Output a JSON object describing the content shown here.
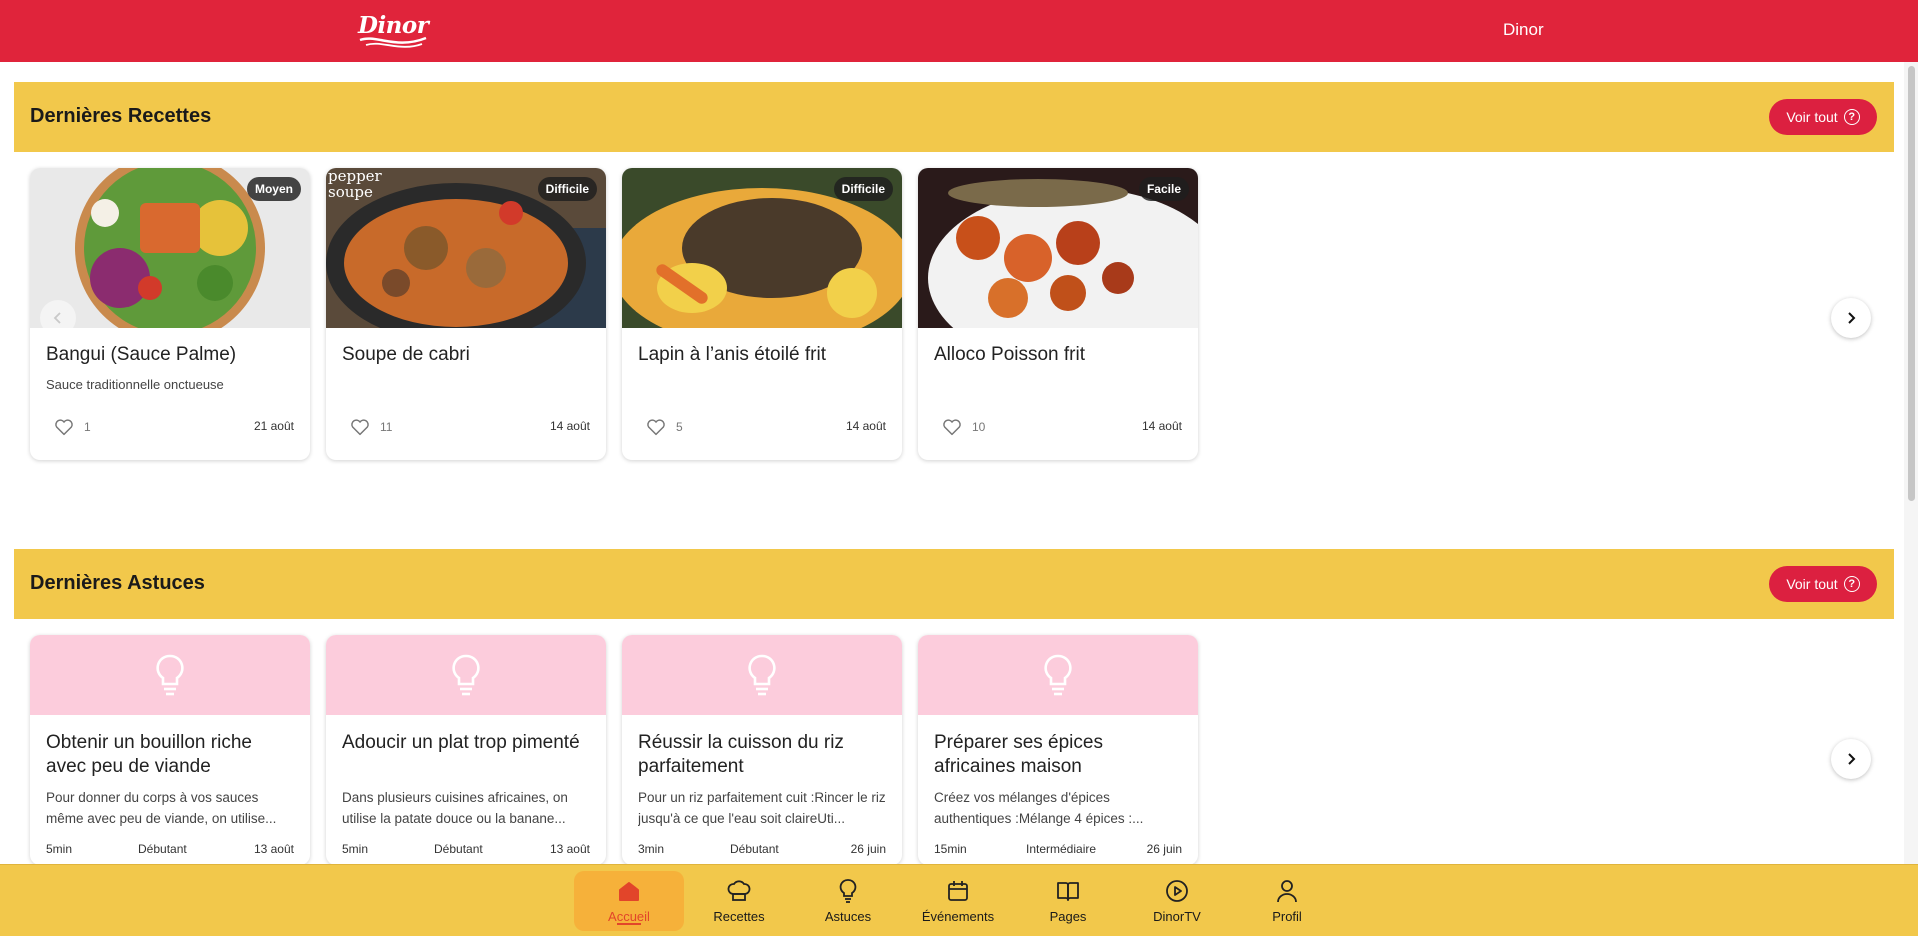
{
  "app": {
    "title": "Dinor",
    "logo_text": "Dinor"
  },
  "colors": {
    "brand_red": "#e0243b",
    "section_yellow": "#f2c84b",
    "tip_pink": "#fcccdc",
    "active_nav": "#f6b13a"
  },
  "recipes_section": {
    "title": "Dernières Recettes",
    "see_all": "Voir tout",
    "cards": [
      {
        "difficulty": "Moyen",
        "title": "Bangui (Sauce Palme)",
        "subtitle": "Sauce traditionnelle onctueuse",
        "likes": "1",
        "date": "21 août"
      },
      {
        "difficulty": "Difficile",
        "title": "Soupe de cabri",
        "subtitle": "",
        "likes": "11",
        "date": "14 août",
        "image_text": "pepper soupe"
      },
      {
        "difficulty": "Difficile",
        "title": "Lapin à l’anis étoilé frit",
        "subtitle": "",
        "likes": "5",
        "date": "14 août"
      },
      {
        "difficulty": "Facile",
        "title": "Alloco Poisson frit",
        "subtitle": "",
        "likes": "10",
        "date": "14 août"
      }
    ]
  },
  "tips_section": {
    "title": "Dernières Astuces",
    "see_all": "Voir tout",
    "cards": [
      {
        "title": "Obtenir un bouillon riche avec peu de viande",
        "desc": "Pour donner du corps à vos sauces même avec peu de viande, on utilise...",
        "duration": "5min",
        "level": "Débutant",
        "date": "13 août"
      },
      {
        "title": "Adoucir un plat trop pimenté",
        "desc": "Dans plusieurs cuisines africaines, on utilise la patate douce ou la banane...",
        "duration": "5min",
        "level": "Débutant",
        "date": "13 août"
      },
      {
        "title": "Réussir la cuisson du riz parfaitement",
        "desc": "Pour un riz parfaitement cuit :Rincer le riz jusqu'à ce que l'eau soit claireUti...",
        "duration": "3min",
        "level": "Débutant",
        "date": "26 juin"
      },
      {
        "title": "Préparer ses épices africaines maison",
        "desc": "Créez vos mélanges d'épices authentiques :Mélange 4 épices :...",
        "duration": "15min",
        "level": "Intermédiaire",
        "date": "26 juin"
      }
    ]
  },
  "bottom_nav": [
    {
      "label": "Accueil",
      "icon": "home-icon",
      "active": true
    },
    {
      "label": "Recettes",
      "icon": "chef-hat-icon"
    },
    {
      "label": "Astuces",
      "icon": "lightbulb-icon"
    },
    {
      "label": "Événements",
      "icon": "calendar-icon"
    },
    {
      "label": "Pages",
      "icon": "book-icon"
    },
    {
      "label": "DinorTV",
      "icon": "play-circle-icon"
    },
    {
      "label": "Profil",
      "icon": "user-icon"
    }
  ]
}
